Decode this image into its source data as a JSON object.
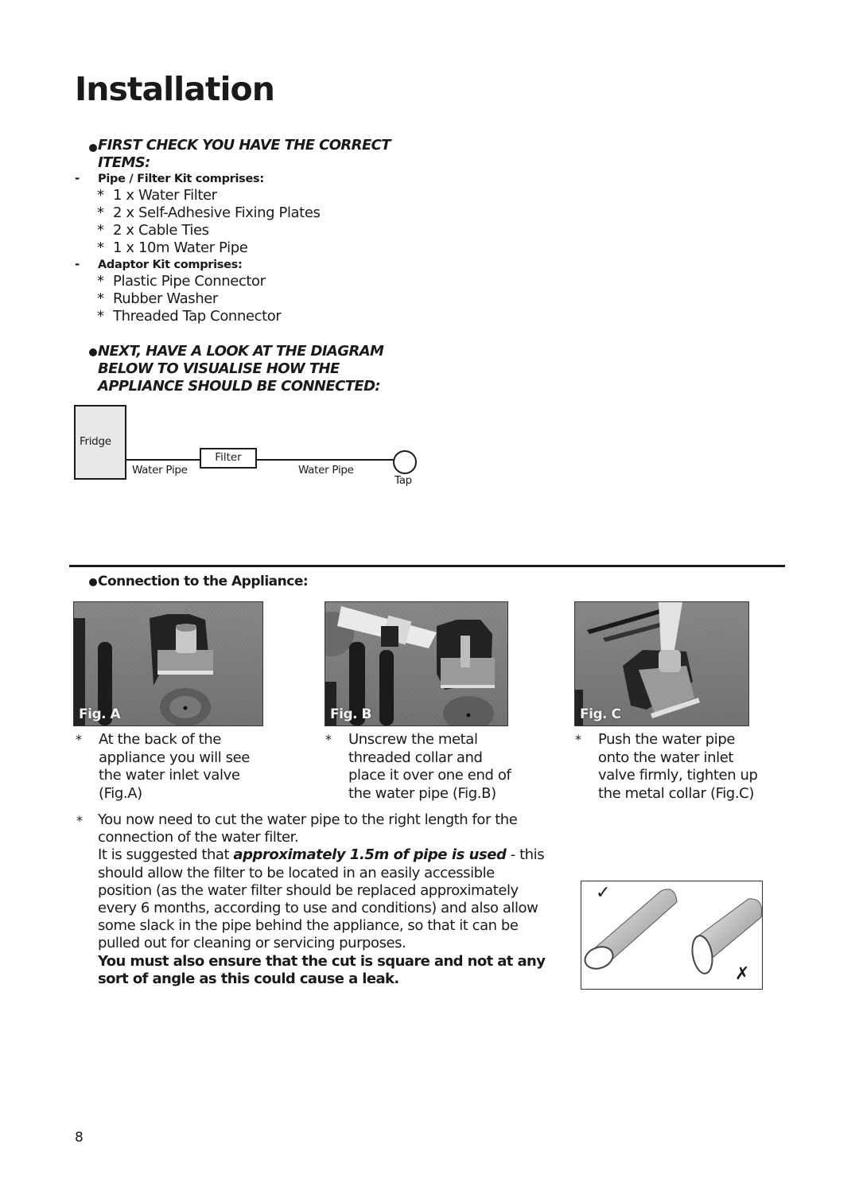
{
  "page": {
    "title": "Installation",
    "number": "8"
  },
  "items_section": {
    "heading_line1": "FIRST CHECK YOU HAVE THE CORRECT",
    "heading_line2": "ITEMS:",
    "kits": [
      {
        "label": "Pipe / Filter Kit comprises:",
        "items": [
          "1 x Water Filter",
          "2 x Self-Adhesive Fixing Plates",
          "2 x Cable Ties",
          "1 x 10m Water Pipe"
        ]
      },
      {
        "label": "Adaptor Kit comprises:",
        "items": [
          "Plastic Pipe Connector",
          "Rubber Washer",
          "Threaded Tap Connector"
        ]
      }
    ],
    "dash": "-",
    "bullet_star": "*"
  },
  "diagram_section": {
    "heading_lines": [
      "NEXT, HAVE A LOOK AT THE DIAGRAM",
      "BELOW TO VISUALISE HOW THE",
      "APPLIANCE SHOULD BE CONNECTED:"
    ],
    "diagram": {
      "fridge": "Fridge",
      "pipe1": "Water Pipe",
      "filter": "Filter",
      "pipe2": "Water Pipe",
      "tap": "Tap"
    }
  },
  "connection_section": {
    "heading": "Connection to the Appliance:",
    "figures": [
      {
        "label": "Fig. A",
        "lines": [
          "At the back of the",
          "appliance you will see",
          "the water inlet valve",
          "(Fig.A)"
        ]
      },
      {
        "label": "Fig. B",
        "lines": [
          "Unscrew the metal",
          "threaded collar and",
          "place it over one end of",
          "the water pipe (Fig.B)"
        ]
      },
      {
        "label": "Fig. C",
        "lines": [
          "Push the water pipe",
          "onto the water inlet",
          "valve firmly, tighten up",
          "the metal collar (Fig.C)"
        ]
      }
    ]
  },
  "cutting_section": {
    "line1": "You now need to cut the water pipe to the right length for the",
    "line2": "connection of the water filter.",
    "line3_pre": "It is suggested that ",
    "line3_emph": "approximately 1.5m of pipe is used",
    "line3_post": " - this",
    "line4": "should allow the filter to be located in an easily accessible",
    "line5": "position (as the water filter should be replaced approximately",
    "line6": "every 6 months, according to use and conditions) and also allow",
    "line7": "some slack in the pipe behind the appliance, so that it can be",
    "line8": "pulled out for cleaning or servicing purposes.",
    "warning_line1": "You must also ensure that the cut is square and not at any",
    "warning_line2": "sort of angle as this could cause a leak.",
    "correct_mark": "✓",
    "wrong_mark": "✗"
  }
}
